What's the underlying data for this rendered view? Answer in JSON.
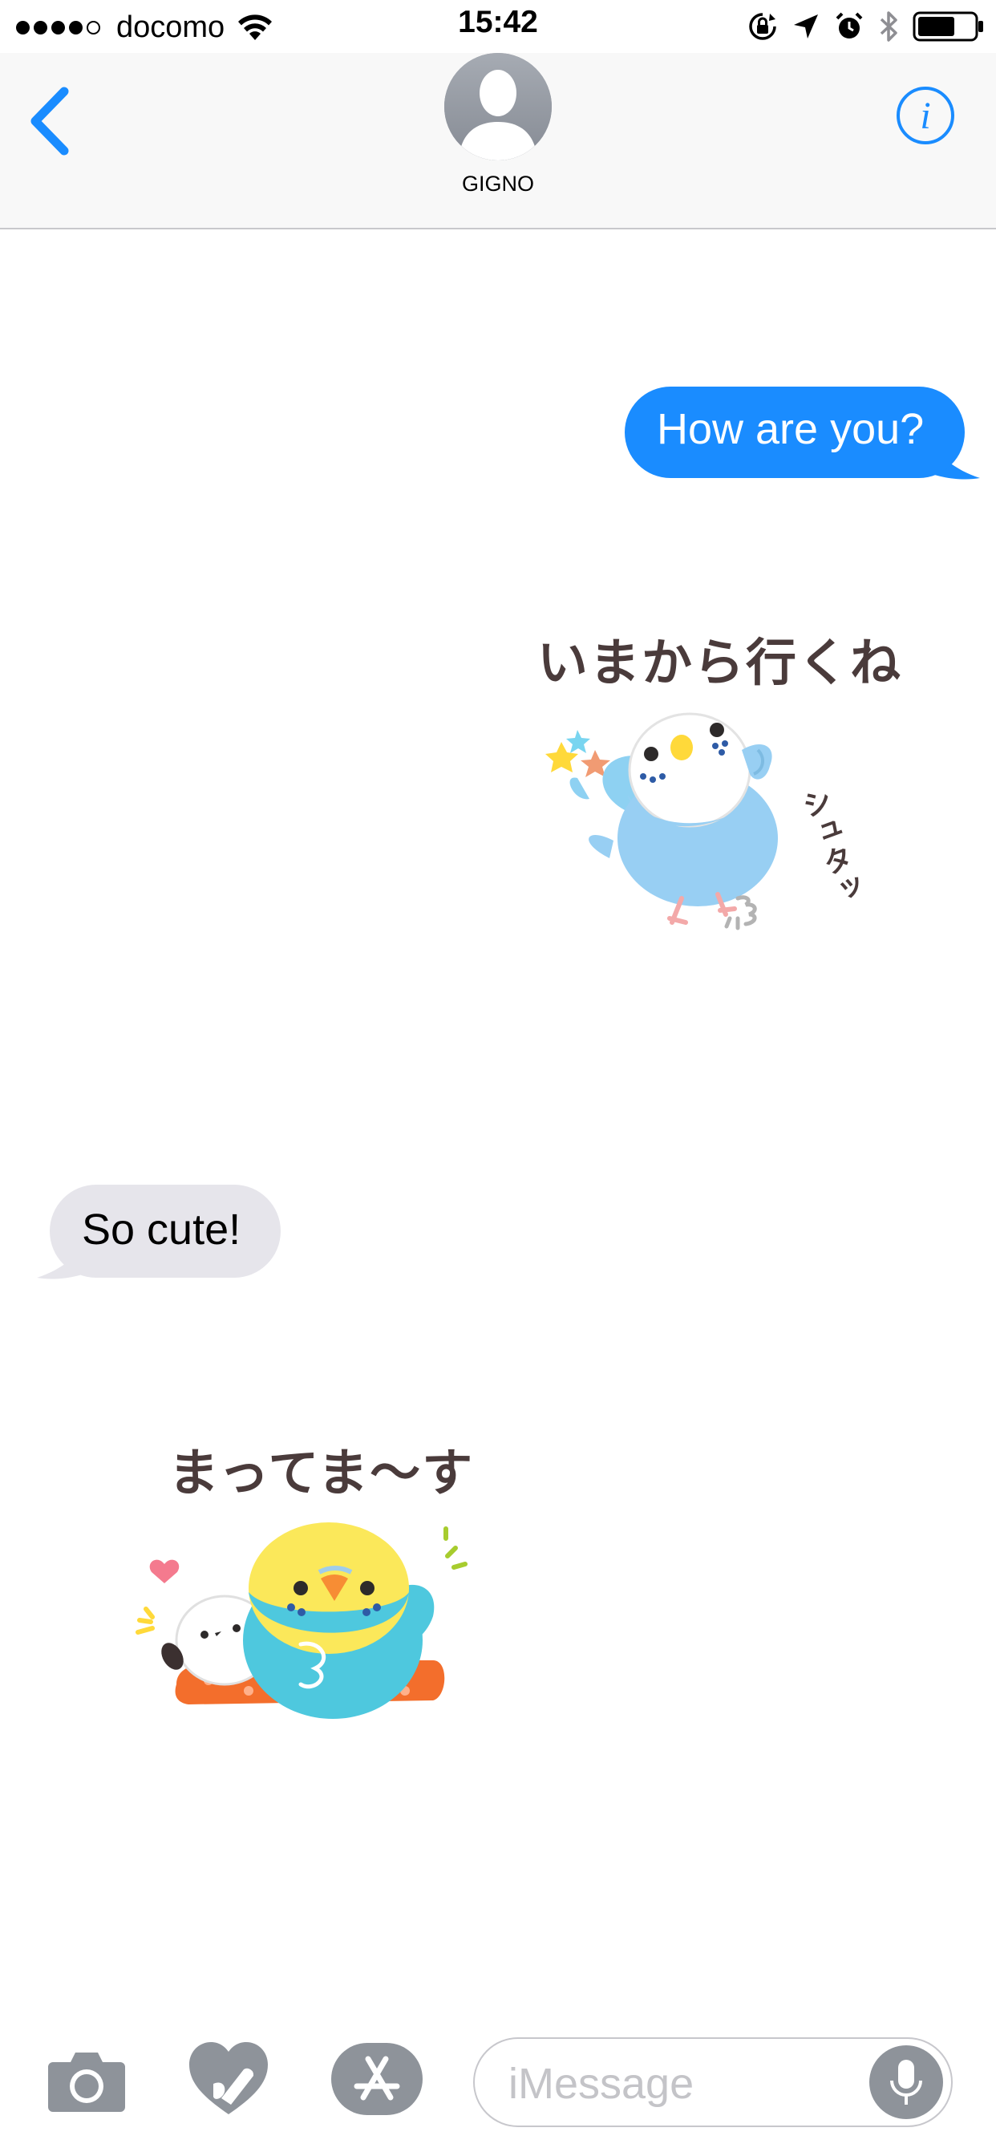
{
  "status_bar": {
    "signal_bars_filled": 4,
    "signal_bars_total": 5,
    "carrier": "docomo",
    "time": "15:42",
    "icons": [
      "wifi-icon",
      "rotation-lock-icon",
      "location-arrow-icon",
      "alarm-icon",
      "bluetooth-icon",
      "battery-icon"
    ]
  },
  "header": {
    "back_icon": "chevron-left-icon",
    "contact_name": "GIGNO",
    "info_icon": "info-icon"
  },
  "messages": [
    {
      "direction": "outgoing",
      "type": "text",
      "text": "How are you?"
    },
    {
      "direction": "outgoing",
      "type": "sticker",
      "caption": "いまから行くね",
      "side_text": "シュタッ"
    },
    {
      "direction": "incoming",
      "type": "text",
      "text": "So cute!"
    },
    {
      "direction": "incoming",
      "type": "sticker",
      "caption": "まってま～す"
    }
  ],
  "toolbar": {
    "camera_icon": "camera-icon",
    "digital_touch_icon": "digital-touch-heart-icon",
    "app_store_icon": "app-store-icon",
    "input_placeholder": "iMessage",
    "mic_icon": "microphone-icon"
  },
  "colors": {
    "outgoing_bubble": "#1a8cff",
    "incoming_bubble": "#e6e5eb",
    "accent": "#1a8cff",
    "toolbar_icon": "#8e939a"
  }
}
